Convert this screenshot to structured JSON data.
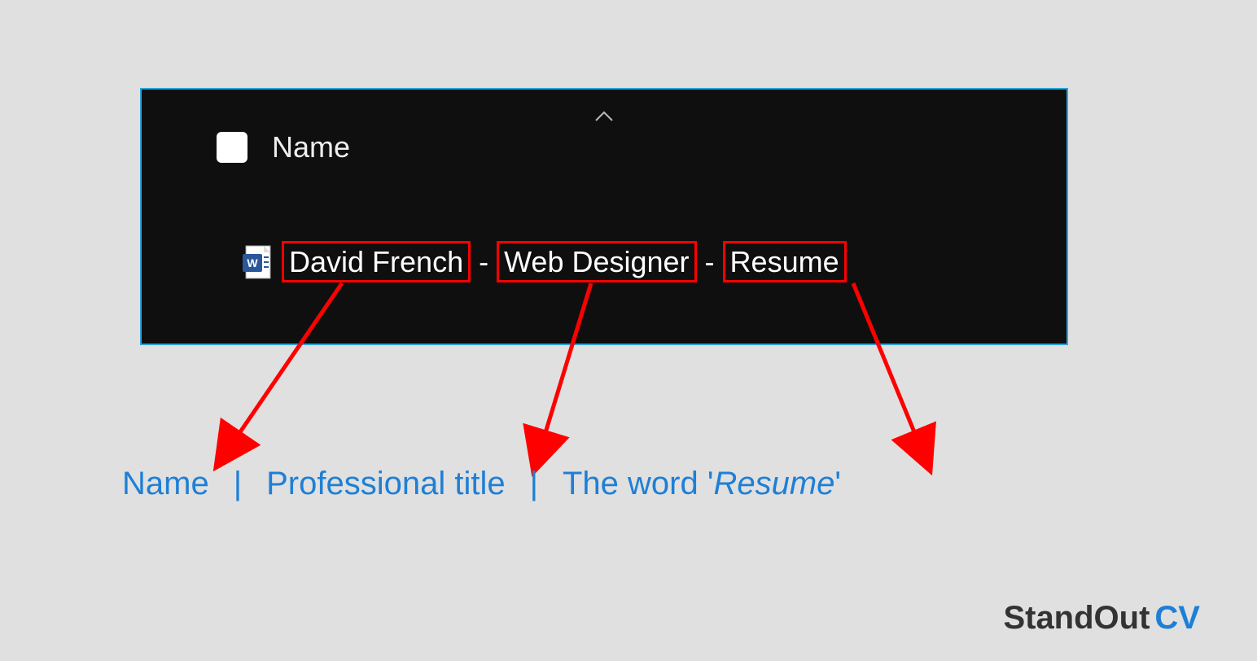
{
  "explorer": {
    "column_header": "Name",
    "file": {
      "part1": "David French",
      "sep": " - ",
      "part2": "Web Designer",
      "part3": "Resume"
    }
  },
  "callouts": {
    "name": "Name",
    "title": "Professional title",
    "resume_prefix": "The word '",
    "resume_word": "Resume",
    "resume_suffix": "'",
    "divider": "|"
  },
  "brand": {
    "standout": "StandOut",
    "cv": "CV"
  }
}
